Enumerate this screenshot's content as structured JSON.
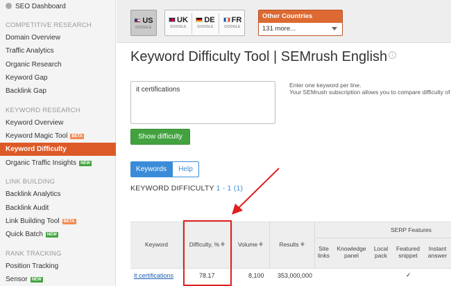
{
  "sidebar": {
    "top_item": "SEO Dashboard",
    "sections": [
      {
        "heading": "COMPETITIVE RESEARCH",
        "items": [
          "Domain Overview",
          "Traffic Analytics",
          "Organic Research",
          "Keyword Gap",
          "Backlink Gap"
        ]
      },
      {
        "heading": "KEYWORD RESEARCH",
        "items": [
          "Keyword Overview",
          "Keyword Magic Tool",
          "Keyword Difficulty",
          "Organic Traffic Insights"
        ]
      },
      {
        "heading": "LINK BUILDING",
        "items": [
          "Backlink Analytics",
          "Backlink Audit",
          "Link Building Tool",
          "Quick Batch"
        ]
      },
      {
        "heading": "RANK TRACKING",
        "items": [
          "Position Tracking",
          "Sensor"
        ]
      }
    ],
    "badges": {
      "beta": "BETA",
      "new": "NEW"
    }
  },
  "databases": {
    "us": {
      "code": "US",
      "engine": "GOOGLE"
    },
    "uk": {
      "code": "UK",
      "engine": "GOOGLE"
    },
    "de": {
      "code": "DE",
      "engine": "GOOGLE"
    },
    "fr": {
      "code": "FR",
      "engine": "GOOGLE"
    }
  },
  "other_countries": {
    "label": "Other Countries",
    "selected": "131 more..."
  },
  "page_title": "Keyword Difficulty Tool | SEMrush English",
  "keyword_input": {
    "value": "it certifications"
  },
  "hint": {
    "line1": "Enter one keyword per line.",
    "line2": "Your SEMrush subscription allows you to compare difficulty of"
  },
  "show_button": "Show difficulty",
  "tabs": {
    "keywords": "Keywords",
    "help": "Help"
  },
  "section": {
    "title": "KEYWORD DIFFICULTY",
    "range": "1 - 1 (1)"
  },
  "table": {
    "headers": {
      "keyword": "Keyword",
      "difficulty": "Difficulty, %",
      "volume": "Volume",
      "results": "Results",
      "serp_features": "SERP Features",
      "site_links": [
        "Site",
        "links"
      ],
      "knowledge_panel": [
        "Knowledge",
        "panel"
      ],
      "local_pack": [
        "Local",
        "pack"
      ],
      "featured_snippet": [
        "Featured",
        "snippet"
      ],
      "instant_answer": [
        "Instant",
        "answer"
      ]
    },
    "row": {
      "keyword": "it certifications",
      "difficulty": "78.17",
      "volume": "8,100",
      "results": "353,000,000",
      "featured_snippet_mark": "✓"
    }
  },
  "colors": {
    "accent_orange": "#dc5a28",
    "green": "#43a23f",
    "blue": "#3b8cd8",
    "annotation_red": "#e01f1f"
  }
}
